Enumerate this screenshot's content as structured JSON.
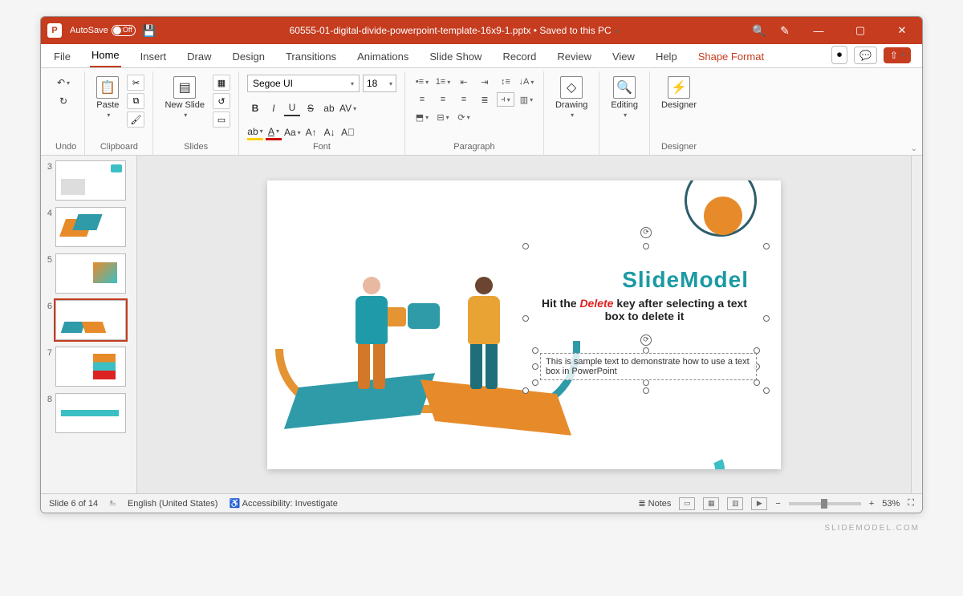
{
  "titlebar": {
    "autosave_label": "AutoSave",
    "autosave_state": "Off",
    "filename": "60555-01-digital-divide-powerpoint-template-16x9-1.pptx",
    "save_state": "Saved to this PC"
  },
  "menu": {
    "items": [
      "File",
      "Home",
      "Insert",
      "Draw",
      "Design",
      "Transitions",
      "Animations",
      "Slide Show",
      "Record",
      "Review",
      "View",
      "Help"
    ],
    "context_tab": "Shape Format",
    "active": "Home"
  },
  "ribbon": {
    "undo_label": "Undo",
    "clipboard_label": "Clipboard",
    "paste_label": "Paste",
    "slides_label": "Slides",
    "new_slide_label": "New Slide",
    "font_label": "Font",
    "font_name": "Segoe UI",
    "font_size": "18",
    "paragraph_label": "Paragraph",
    "drawing_label": "Drawing",
    "editing_label": "Editing",
    "designer_label": "Designer"
  },
  "thumbnails": {
    "visible": [
      3,
      4,
      5,
      6,
      7,
      8
    ],
    "active": 6
  },
  "slide": {
    "title": "SlideModel",
    "subtitle_pre": "Hit the ",
    "subtitle_em": "Delete",
    "subtitle_post": " key after selecting a text box to delete it",
    "sample_text": "This is sample text to demonstrate how to use a text box in PowerPoint"
  },
  "status": {
    "slide_counter": "Slide 6 of 14",
    "language": "English (United States)",
    "accessibility": "Accessibility: Investigate",
    "notes_label": "Notes",
    "zoom": "53%"
  },
  "watermark": "SLIDEMODEL.COM"
}
